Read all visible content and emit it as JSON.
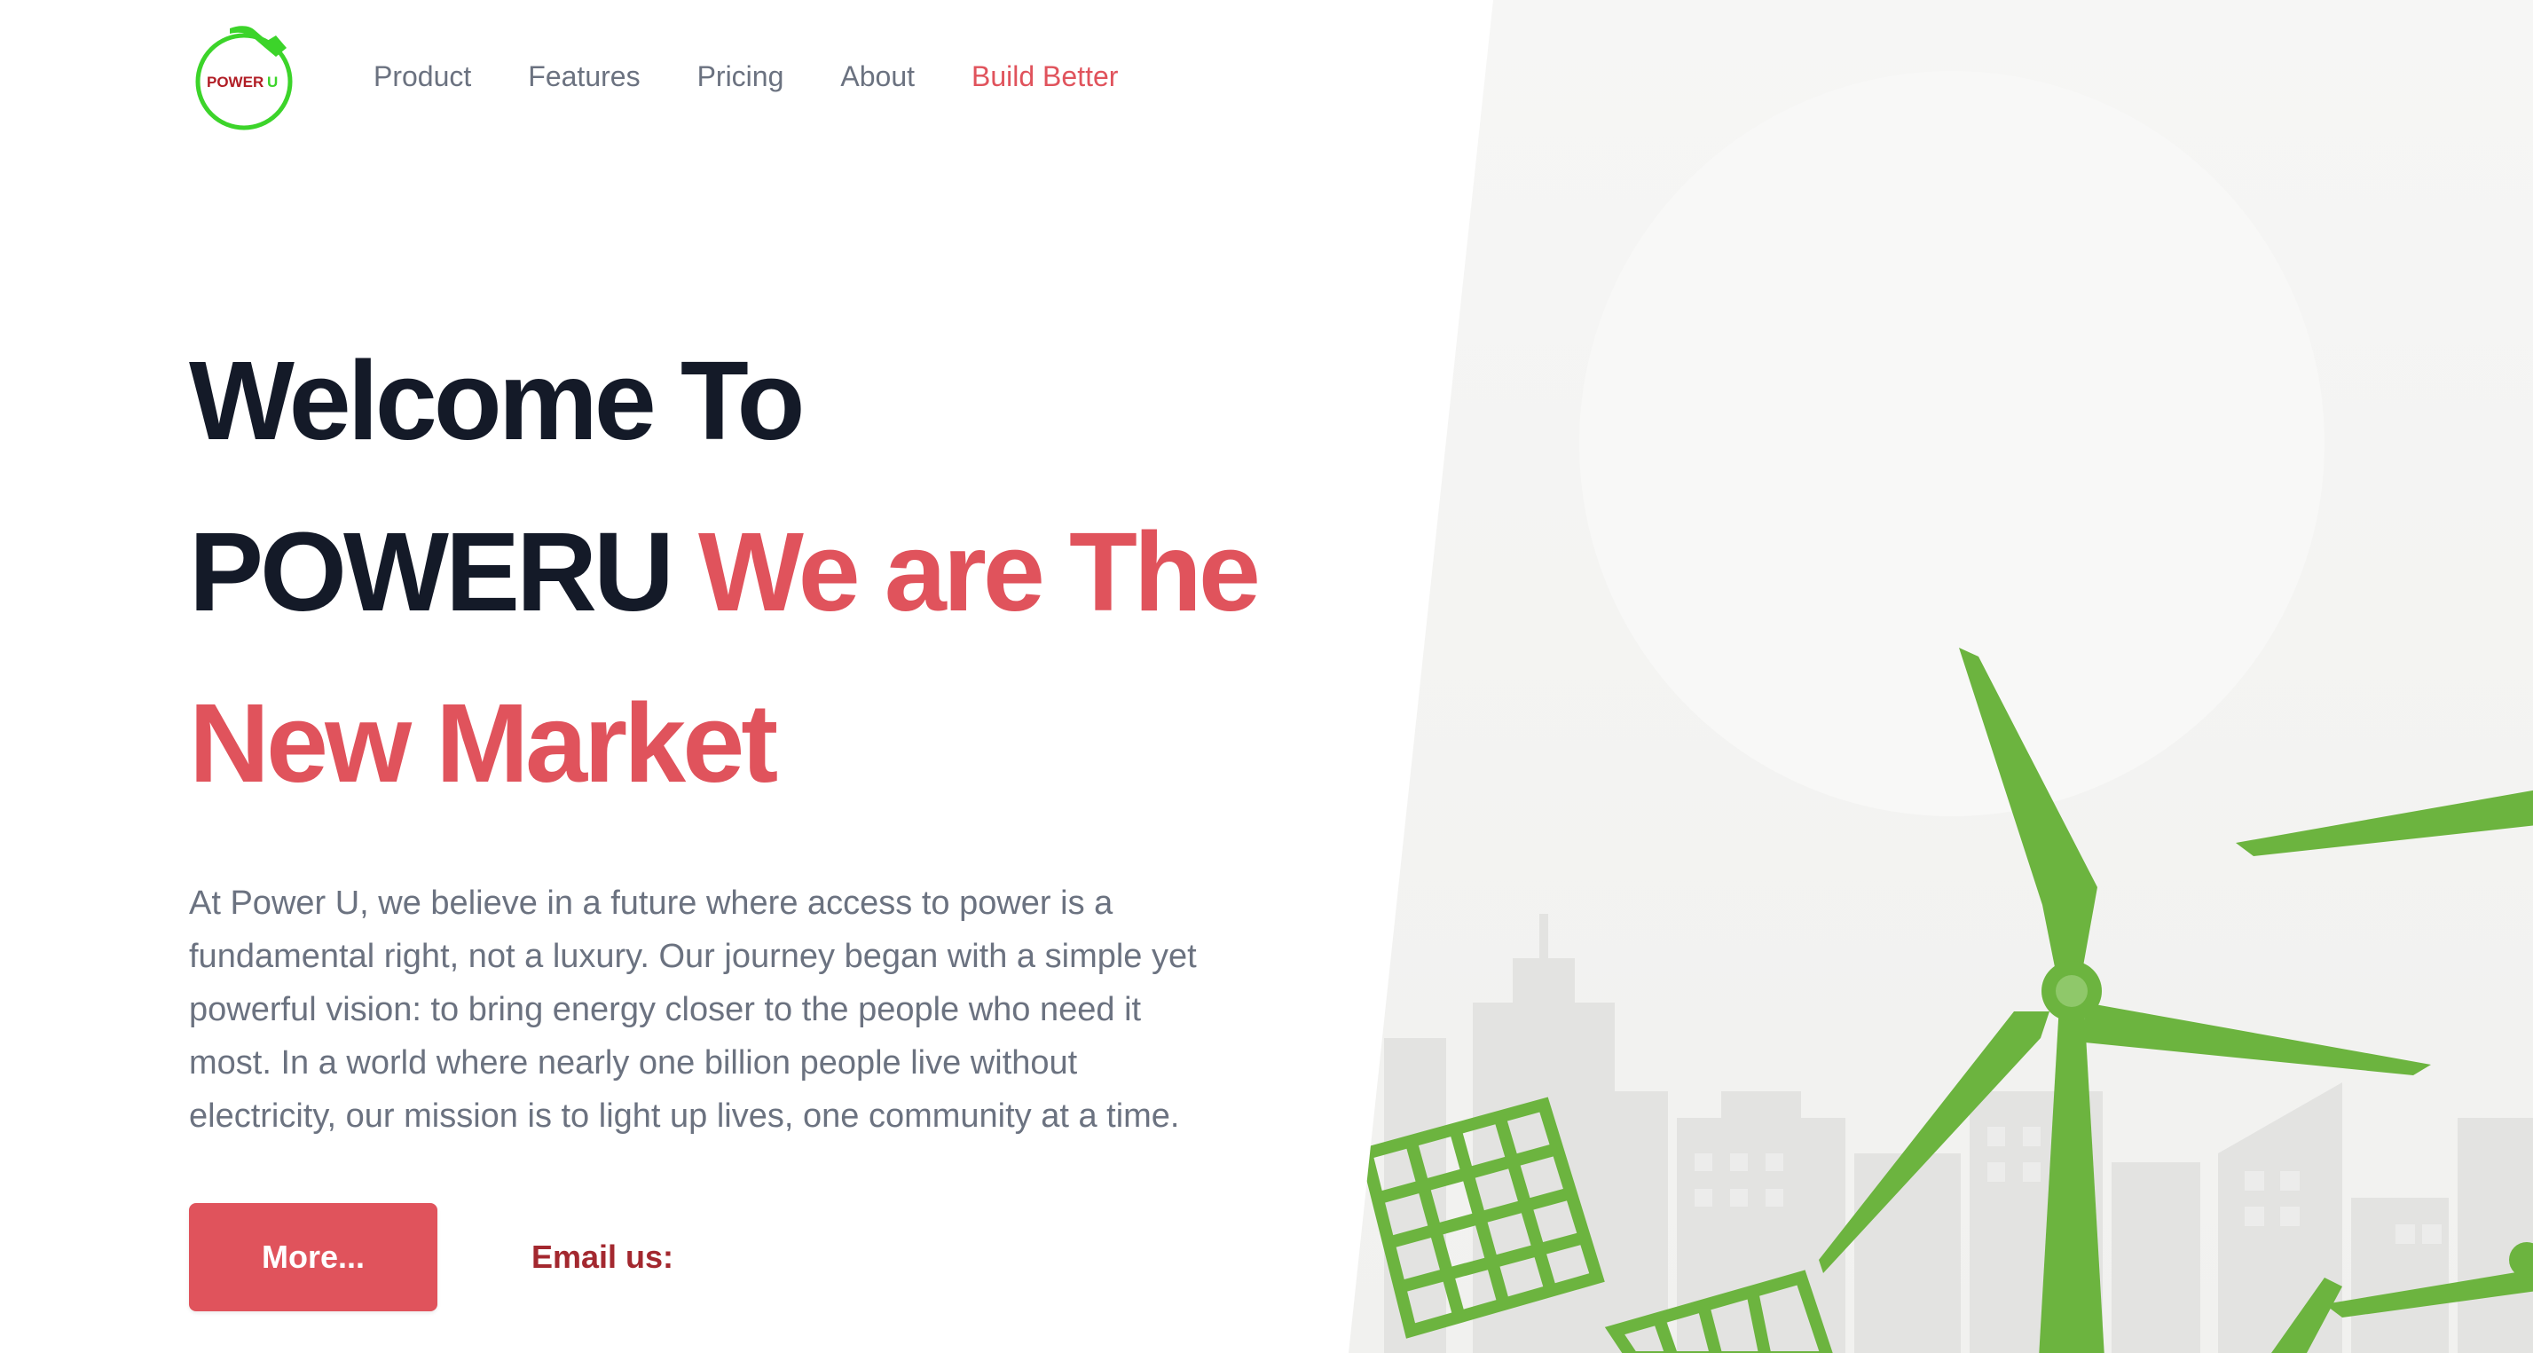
{
  "brand": {
    "logo_text": "POWERU",
    "logo_icon": "fuel-nozzle-ring-icon",
    "accent_color": "#e0535c",
    "logo_green": "#3cd42a"
  },
  "nav": {
    "items": [
      {
        "label": "Product",
        "accent": false
      },
      {
        "label": "Features",
        "accent": false
      },
      {
        "label": "Pricing",
        "accent": false
      },
      {
        "label": "About",
        "accent": false
      },
      {
        "label": "Build Better",
        "accent": true
      }
    ]
  },
  "hero": {
    "headline_line1": "Welcome To",
    "headline_brand": "POWERU",
    "headline_accent_1": "We are The",
    "headline_accent_2": "New Market",
    "description": "At Power U, we believe in a future where access to power is a fundamental right, not a luxury. Our journey began with a simple yet powerful vision: to bring energy closer to the people who need it most. In a world where nearly one billion people live without electricity, our mission is to light up lives, one community at a time.",
    "more_button": "More...",
    "email_label": "Email us:"
  },
  "image": {
    "subject_icons": [
      "wind-turbine-icon",
      "solar-panel-icon",
      "city-skyline-icon"
    ],
    "turbine_color": "#6cb43f",
    "city_color": "#e0e0e0"
  }
}
